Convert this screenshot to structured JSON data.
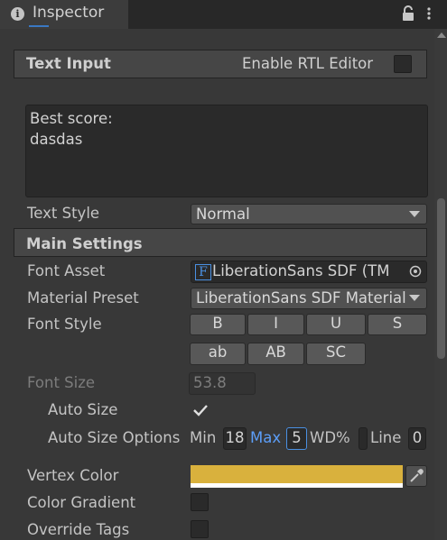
{
  "tab": {
    "title": "Inspector"
  },
  "icons": {
    "info": "info-icon",
    "lock": "lock-icon",
    "menu": "kebab-menu-icon",
    "font_asset": "font-asset-icon",
    "picker": "object-picker-icon",
    "eyedropper": "eyedropper-icon",
    "check": "checkmark-icon"
  },
  "text_input": {
    "title": "Text Input",
    "rtl_label": "Enable RTL Editor",
    "rtl_checked": false,
    "text_lines": [
      "Best score:",
      "dasdas"
    ],
    "text_style_label": "Text Style",
    "text_style_value": "Normal"
  },
  "main_settings": {
    "title": "Main Settings",
    "font_asset_label": "Font Asset",
    "font_asset_value": "LiberationSans SDF (TM",
    "font_asset_glyph": "F",
    "material_preset_label": "Material Preset",
    "material_preset_value": "LiberationSans SDF Material",
    "font_style_label": "Font Style",
    "font_style_row1": [
      "B",
      "I",
      "U",
      "S"
    ],
    "font_style_row2": [
      "ab",
      "AB",
      "SC"
    ],
    "font_size_label": "Font Size",
    "font_size_value": "53.8",
    "auto_size_label": "Auto Size",
    "auto_size_checked": true,
    "auto_size_options_label": "Auto Size Options",
    "min_label": "Min",
    "min_value": "18",
    "max_label": "Max",
    "max_value": "5",
    "wd_label": "WD%",
    "line_label": "Line",
    "line_value": "0",
    "vertex_color_label": "Vertex Color",
    "vertex_color": "#d9b13d",
    "color_gradient_label": "Color Gradient",
    "color_gradient_checked": false,
    "override_tags_label": "Override Tags",
    "override_tags_checked": false
  },
  "colors": {
    "accent": "#3a78c3",
    "max_label": "#5c9ef8"
  }
}
